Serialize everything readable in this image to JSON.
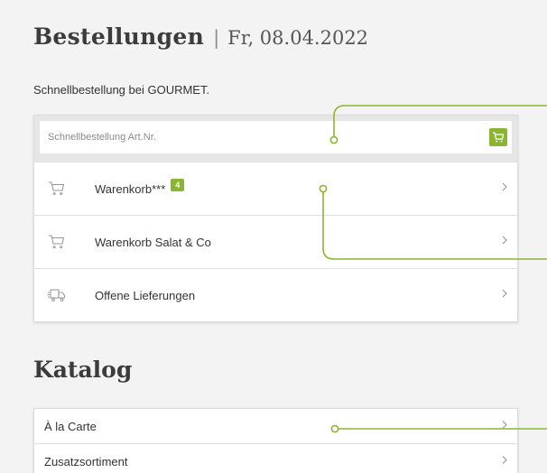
{
  "header": {
    "title": "Bestellungen",
    "separator": "|",
    "date": "Fr, 08.04.2022"
  },
  "subtitle": "Schnellbestellung bei GOURMET.",
  "quick_order": {
    "placeholder": "Schnellbestellung Art.Nr.",
    "button_icon": "cart-icon"
  },
  "order_items": [
    {
      "label": "Warenkorb***",
      "badge": "4",
      "icon": "cart-icon"
    },
    {
      "label": "Warenkorb Salat & Co",
      "icon": "cart-icon"
    },
    {
      "label": "Offene Lieferungen",
      "icon": "delivery-truck-icon"
    }
  ],
  "catalog": {
    "title": "Katalog",
    "items": [
      {
        "label": "À la Carte"
      },
      {
        "label": "Zusatzsortiment"
      }
    ]
  },
  "colors": {
    "accent": "#8bb531",
    "background": "#f3f3f3",
    "callout": "#8bb531"
  }
}
